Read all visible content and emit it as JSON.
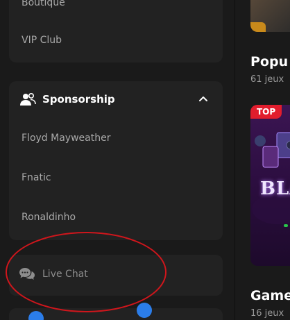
{
  "sidebar": {
    "top_items": [
      {
        "label": "Boutique"
      },
      {
        "label": "VIP Club"
      }
    ],
    "sponsorship": {
      "title": "Sponsorship",
      "icon": "users-icon",
      "items": [
        {
          "label": "Floyd Mayweather"
        },
        {
          "label": "Fnatic"
        },
        {
          "label": "Ronaldinho"
        }
      ]
    },
    "live_chat": {
      "label": "Live Chat",
      "icon": "chat-bubbles-icon"
    }
  },
  "main": {
    "sections": [
      {
        "title": "Popu",
        "count": "61 jeux"
      },
      {
        "title": "Game",
        "count": "16 jeux"
      }
    ],
    "game_card": {
      "badge": "TOP",
      "title": "BLA"
    }
  },
  "colors": {
    "background": "#1a1a1a",
    "card": "#222222",
    "annotation": "#d0161c",
    "badge": "#e11d2d",
    "accent_green": "#29c74b"
  }
}
